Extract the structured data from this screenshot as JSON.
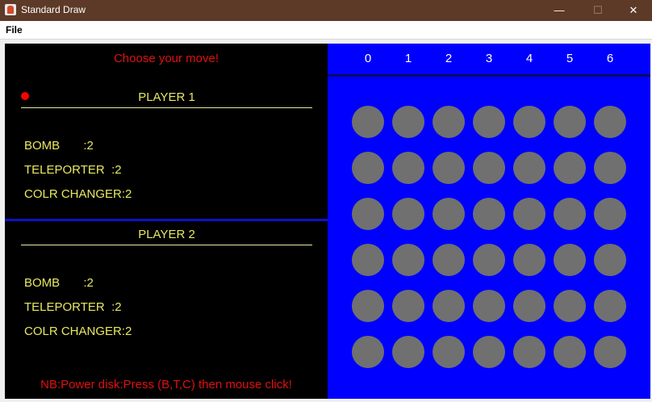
{
  "window": {
    "title": "Standard Draw",
    "minimize": "—",
    "maximize": "☐",
    "close": "✕"
  },
  "menu": {
    "file": "File"
  },
  "status": {
    "prompt": "Choose your move!",
    "note": "NB:Power disk:Press (B,T,C) then mouse click!",
    "turn_color": "#ff0000"
  },
  "players": [
    {
      "name": "PLAYER 1",
      "bomb": "BOMB       :2",
      "teleporter": "TELEPORTER  :2",
      "color_changer": "COLR CHANGER:2"
    },
    {
      "name": "PLAYER 2",
      "bomb": "BOMB       :2",
      "teleporter": "TELEPORTER  :2",
      "color_changer": "COLR CHANGER:2"
    }
  ],
  "board": {
    "columns": [
      "0",
      "1",
      "2",
      "3",
      "4",
      "5",
      "6"
    ],
    "rows": 6,
    "background": "#0000ff",
    "empty_color": "#707070"
  }
}
